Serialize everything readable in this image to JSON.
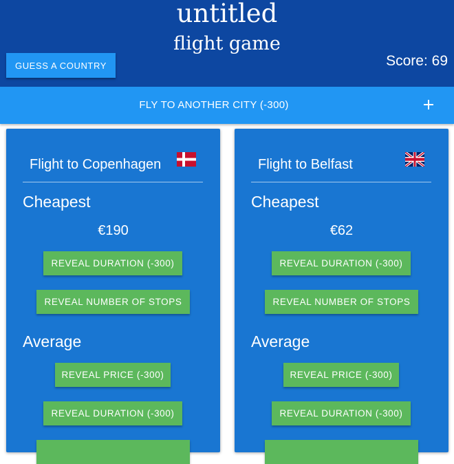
{
  "header": {
    "title_line1": "untitled",
    "title_line2": "flight game",
    "guess_button_label": "GUESS A COUNTRY",
    "score_text": "Score: 69"
  },
  "flybar": {
    "label": "FLY TO ANOTHER CITY (-300)",
    "icon": "plus-icon"
  },
  "cards": [
    {
      "title": "Flight to Copenhagen",
      "flag": "denmark-flag-icon",
      "cheapest_heading": "Cheapest",
      "cheapest_price": "€190",
      "reveal_duration_label": "REVEAL DURATION (-300)",
      "reveal_stops_label": "REVEAL NUMBER OF STOPS",
      "average_heading": "Average",
      "reveal_price_label": "REVEAL PRICE (-300)",
      "avg_reveal_duration_label": "REVEAL DURATION (-300)"
    },
    {
      "title": "Flight to Belfast",
      "flag": "uk-flag-icon",
      "cheapest_heading": "Cheapest",
      "cheapest_price": "€62",
      "reveal_duration_label": "REVEAL DURATION (-300)",
      "reveal_stops_label": "REVEAL NUMBER OF STOPS",
      "average_heading": "Average",
      "reveal_price_label": "REVEAL PRICE (-300)",
      "avg_reveal_duration_label": "REVEAL DURATION (-300)"
    }
  ],
  "colors": {
    "header_bg": "#0d47a1",
    "flybar_bg": "#2196f3",
    "card_bg": "#1976d2",
    "action_button_bg": "#5cb85c"
  }
}
